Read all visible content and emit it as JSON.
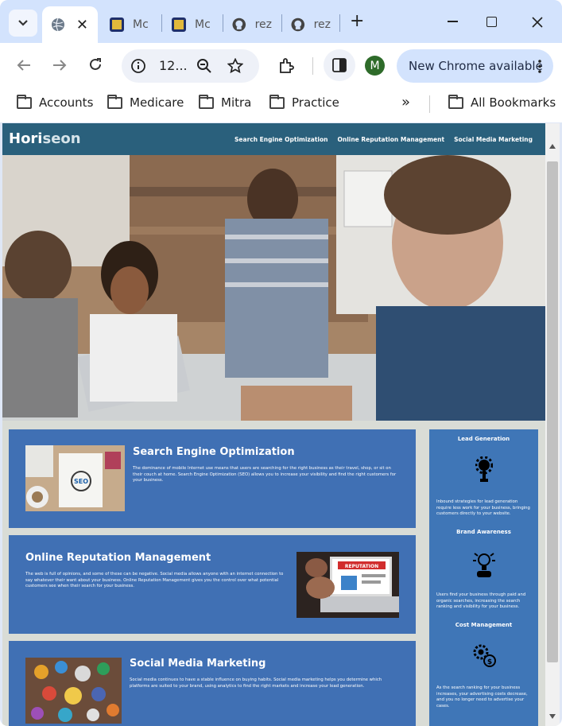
{
  "browser": {
    "tabs": [
      {
        "label": "",
        "close": "✕"
      },
      {
        "label": "Mc"
      },
      {
        "label": "Mc"
      },
      {
        "label": "rez"
      },
      {
        "label": "rez"
      }
    ],
    "new_tab": "+",
    "address": "12...",
    "update_button": "New Chrome available",
    "profile_initial": "M",
    "bookmarks": [
      "Accounts",
      "Medicare",
      "Mitra",
      "Practice"
    ],
    "more_bookmarks": "»",
    "all_bookmarks": "All Bookmarks"
  },
  "site": {
    "logo_prefix": "Hori",
    "logo_suffix": "seon",
    "nav": [
      "Search Engine Optimization",
      "Online Reputation Management",
      "Social Media Marketing"
    ],
    "cards": [
      {
        "title": "Search Engine Optimization",
        "text": "The dominance of mobile Internet use means that users are searching for the right business as their travel, shop, or sit on their couch at home. Search Engine Optimization (SEO) allows you to increase your visibility and find the right customers for your business."
      },
      {
        "title": "Online Reputation Management",
        "text": "The web is full of opinions, and some of these can be negative. Social media allows anyone with an internet connection to say whatever their want about your business. Online Reputation Management gives you the control over what potential customers see when their search for your business."
      },
      {
        "title": "Social Media Marketing",
        "text": "Social media continues to have a stable influence on buying habits. Social media marketing helps you determine which platforms are suited to your brand, using analytics to find the right markets and increase your lead generation."
      }
    ],
    "benefits": [
      {
        "title": "Lead Generation",
        "text": "Inbound strategies for lead generation require less work for your business, bringing customers directly to your website."
      },
      {
        "title": "Brand Awareness",
        "text": "Users find your business through paid and organic searches, increasing the search ranking and visibility for your business."
      },
      {
        "title": "Cost Management",
        "text": "As the search ranking for your business increases, your advertising costs decrease, and you no longer need to advertise your cases."
      }
    ],
    "seo_image_word": "SEO",
    "reputation_image_word": "REPUTATION"
  },
  "colors": {
    "header": "#2a607c",
    "card": "#4070b4",
    "sidebar": "#3f76b7",
    "tabstrip": "#d3e3fd"
  }
}
